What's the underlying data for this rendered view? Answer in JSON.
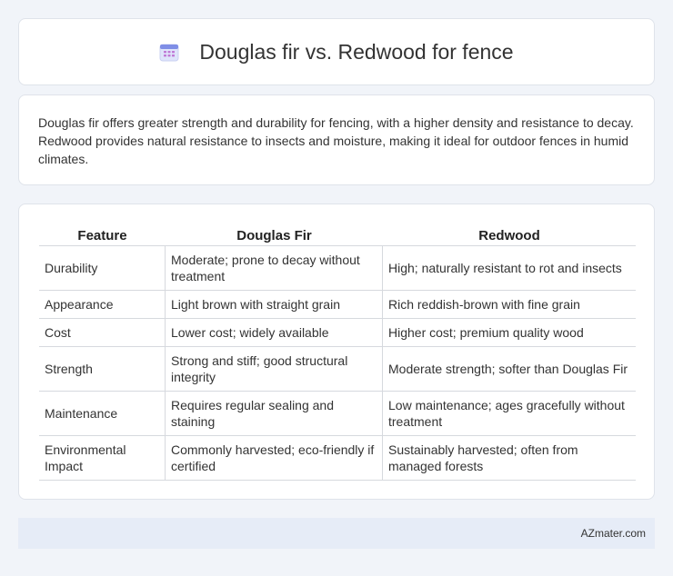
{
  "header": {
    "title": "Douglas fir vs. Redwood for fence",
    "icon": "calendar-icon"
  },
  "summary": {
    "text": "Douglas fir offers greater strength and durability for fencing, with a higher density and resistance to decay. Redwood provides natural resistance to insects and moisture, making it ideal for outdoor fences in humid climates."
  },
  "table": {
    "headers": [
      "Feature",
      "Douglas Fir",
      "Redwood"
    ],
    "rows": [
      [
        "Durability",
        "Moderate; prone to decay without treatment",
        "High; naturally resistant to rot and insects"
      ],
      [
        "Appearance",
        "Light brown with straight grain",
        "Rich reddish-brown with fine grain"
      ],
      [
        "Cost",
        "Lower cost; widely available",
        "Higher cost; premium quality wood"
      ],
      [
        "Strength",
        "Strong and stiff; good structural integrity",
        "Moderate strength; softer than Douglas Fir"
      ],
      [
        "Maintenance",
        "Requires regular sealing and staining",
        "Low maintenance; ages gracefully without treatment"
      ],
      [
        "Environmental Impact",
        "Commonly harvested; eco-friendly if certified",
        "Sustainably harvested; often from managed forests"
      ]
    ]
  },
  "footer": {
    "brand": "AZmater.com"
  }
}
